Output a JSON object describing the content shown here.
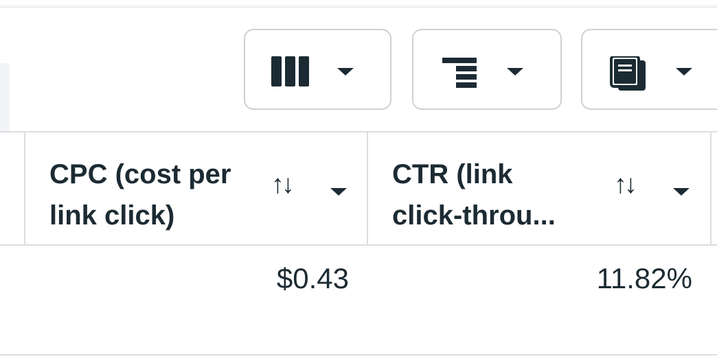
{
  "toolbar": {
    "buttons": [
      {
        "name": "columns",
        "icon": "columns-icon"
      },
      {
        "name": "breakdown",
        "icon": "breakdown-icon"
      },
      {
        "name": "reports",
        "icon": "reports-icon"
      }
    ]
  },
  "table": {
    "columns": [
      {
        "header": "CPC (cost per\nlink click)",
        "value": "$0.43"
      },
      {
        "header": "CTR (link\nclick-throu...",
        "value": "11.82%"
      }
    ],
    "sort_icon": "↑↓"
  },
  "colors": {
    "text": "#1c2b33",
    "border": "#dadde1",
    "button_border": "#ced0d4"
  }
}
